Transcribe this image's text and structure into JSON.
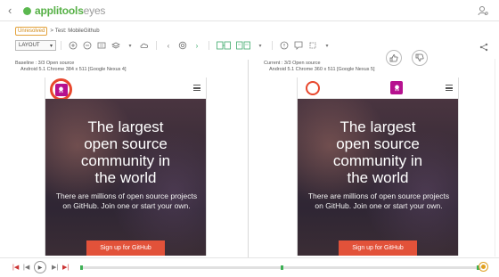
{
  "header": {
    "back_icon": "‹",
    "logo_primary": "applitools",
    "logo_secondary": "eyes",
    "brand_color": "#56b046"
  },
  "breadcrumb": {
    "status": "Unresolved",
    "separator": ">",
    "test_name": "Test: MobileGithub"
  },
  "toolbar": {
    "layout_label": "LAYOUT",
    "layout_caret": "▾"
  },
  "baseline": {
    "title": "Baseline : 3/3 Open source",
    "env": "Android 5.1   Chrome   384 x 511   [Google Nexus 4]"
  },
  "current": {
    "title": "Current : 3/3 Open source",
    "env": "Android 5.1   Chrome   360 x 511   [Google Nexus 5]"
  },
  "page": {
    "headline": "The largest open source community in the world",
    "subtext": "There are millions of open source projects on GitHub. Join one or start your own.",
    "cta": "Sign up for GitHub",
    "cta_color": "#e2523a"
  },
  "highlight_color": "#e8472d"
}
